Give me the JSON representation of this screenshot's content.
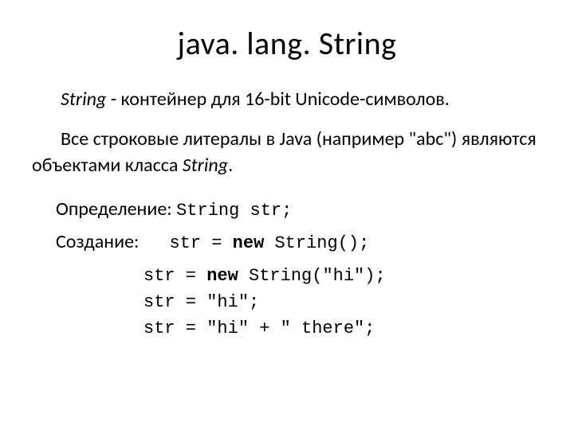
{
  "title": "java. lang. String",
  "para1": {
    "lead_italic": "String",
    "rest": " - контейнер для 16-bit Unicode-символов."
  },
  "para2": {
    "part1": "Все строковые литералы в Java (например \"abc\") являются объектами класса ",
    "italic": "String",
    "part2": "."
  },
  "definition": {
    "label": "Определение: ",
    "code": "String str;"
  },
  "creation": {
    "label": "Создание:",
    "first_prefix": "str = ",
    "first_kw": "new",
    "first_rest": " String();",
    "lines": [
      {
        "prefix": "str = ",
        "kw": "new",
        "rest": " String(\"hi\");"
      },
      {
        "prefix": "str = \"hi\";",
        "kw": "",
        "rest": ""
      },
      {
        "prefix": "str = \"hi\" + \" there\";",
        "kw": "",
        "rest": ""
      }
    ]
  }
}
